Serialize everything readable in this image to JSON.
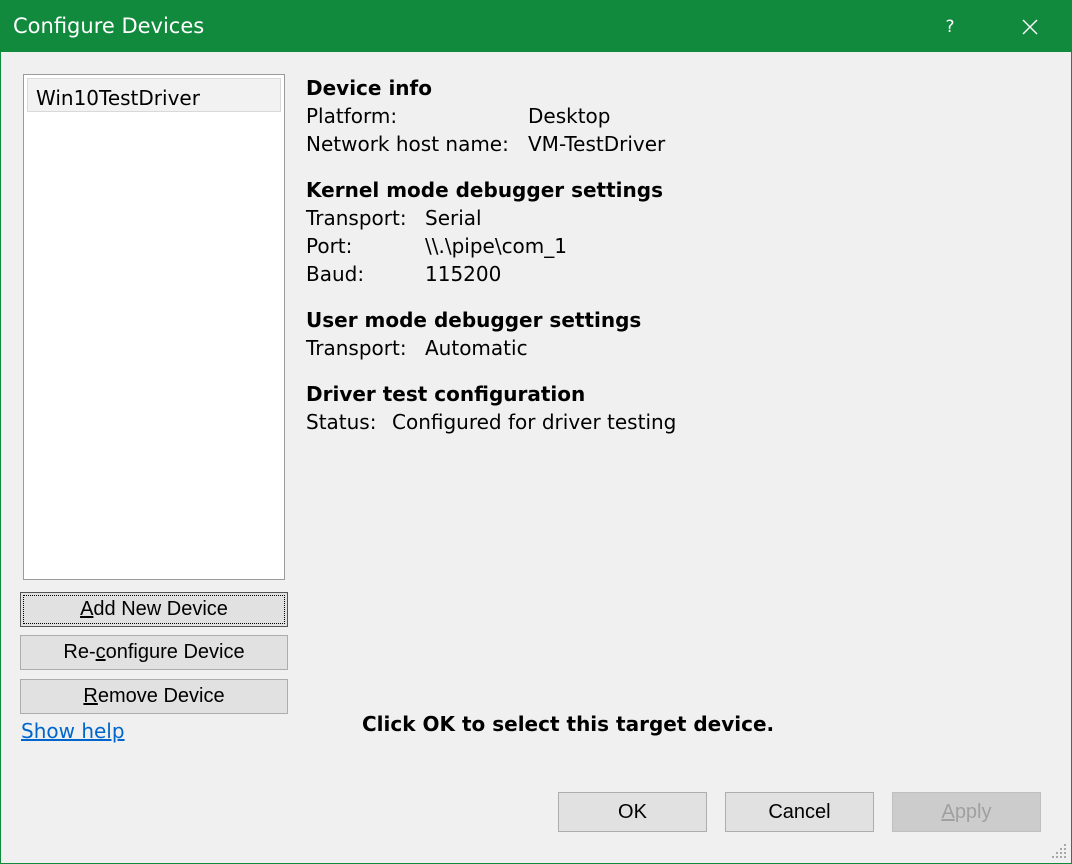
{
  "window": {
    "title": "Configure Devices",
    "help_glyph": "?",
    "close_icon": "close-icon"
  },
  "devices": [
    {
      "label": "Win10TestDriver",
      "selected": true
    }
  ],
  "buttons": {
    "add": {
      "pre": "",
      "acc": "A",
      "post": "dd New Device"
    },
    "reconfigure": {
      "pre": "Re-",
      "acc": "c",
      "post": "onfigure Device"
    },
    "remove": {
      "pre": "",
      "acc": "R",
      "post": "emove Device"
    },
    "ok": "OK",
    "cancel": "Cancel",
    "apply": {
      "acc": "A",
      "post": "pply",
      "disabled": true
    }
  },
  "show_help": "Show help",
  "device_info": {
    "heading": "Device info",
    "platform_label": "Platform:",
    "platform_value": "Desktop",
    "host_label": "Network host name:",
    "host_value": "VM-TestDriver"
  },
  "kernel": {
    "heading": "Kernel mode debugger settings",
    "transport_label": "Transport:",
    "transport_value": "Serial",
    "port_label": "Port:",
    "port_value": "\\\\.\\pipe\\com_1",
    "baud_label": "Baud:",
    "baud_value": "115200"
  },
  "user_mode": {
    "heading": "User mode debugger settings",
    "transport_label": "Transport:",
    "transport_value": "Automatic"
  },
  "driver_test": {
    "heading": "Driver test configuration",
    "status_label": "Status:",
    "status_value": "Configured for driver testing"
  },
  "hint": "Click OK to select this target device.",
  "colors": {
    "titlebar": "#118a3d",
    "link": "#0066cc",
    "background": "#f0f0f0"
  }
}
